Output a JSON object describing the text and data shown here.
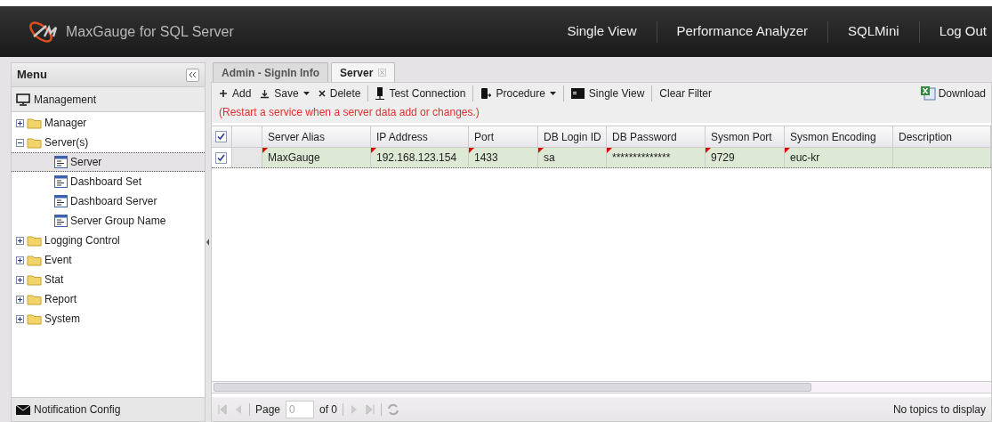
{
  "header": {
    "product": "MaxGauge for SQL Server",
    "nav": [
      {
        "label": "Single View"
      },
      {
        "label": "Performance Analyzer"
      },
      {
        "label": "SQLMini"
      },
      {
        "label": "Log Out"
      }
    ]
  },
  "sidebar": {
    "title": "Menu",
    "section": "Management",
    "tree": [
      {
        "label": "Manager",
        "expanded": false,
        "selected": false
      },
      {
        "label": "Server(s)",
        "expanded": true,
        "selected": false,
        "children": [
          {
            "label": "Server",
            "selected": true
          },
          {
            "label": "Dashboard Set",
            "selected": false
          },
          {
            "label": "Dashboard Server",
            "selected": false
          },
          {
            "label": "Server Group Name",
            "selected": false
          }
        ]
      },
      {
        "label": "Logging Control",
        "expanded": false,
        "selected": false
      },
      {
        "label": "Event",
        "expanded": false,
        "selected": false
      },
      {
        "label": "Stat",
        "expanded": false,
        "selected": false
      },
      {
        "label": "Report",
        "expanded": false,
        "selected": false
      },
      {
        "label": "System",
        "expanded": false,
        "selected": false
      }
    ],
    "footer": "Notification Config"
  },
  "tabs": [
    {
      "label": "Admin - SignIn Info",
      "selected": false,
      "closable": false
    },
    {
      "label": "Server",
      "selected": true,
      "closable": true
    }
  ],
  "toolbar": [
    {
      "label": "Add",
      "kind": "add",
      "dropdown": false,
      "separator_before": false
    },
    {
      "label": "Save",
      "kind": "save",
      "dropdown": true,
      "separator_before": false
    },
    {
      "label": "Delete",
      "kind": "delete",
      "dropdown": false,
      "separator_before": false
    },
    {
      "label": "Test Connection",
      "kind": "test",
      "dropdown": false,
      "separator_before": true
    },
    {
      "label": "Procedure",
      "kind": "procedure",
      "dropdown": true,
      "separator_before": true
    },
    {
      "label": "Single View",
      "kind": "view",
      "dropdown": false,
      "separator_before": true
    },
    {
      "label": "Clear Filter",
      "kind": "plain",
      "dropdown": false,
      "separator_before": true
    }
  ],
  "download": "Download",
  "notice": "(Restart a service when a server data add or changes.)",
  "table": {
    "all_checked": true,
    "columns": [
      "Server Alias",
      "IP Address",
      "Port",
      "DB Login ID",
      "DB Password",
      "Sysmon Port",
      "Sysmon Encoding",
      "Description"
    ],
    "rows": [
      {
        "checked": true,
        "selected": true,
        "cells": [
          {
            "text": "MaxGauge",
            "modified": true
          },
          {
            "text": "192.168.123.154",
            "modified": true
          },
          {
            "text": "1433",
            "modified": true
          },
          {
            "text": "sa",
            "modified": true
          },
          {
            "text": "**************",
            "modified": true
          },
          {
            "text": "9729",
            "modified": true
          },
          {
            "text": "euc-kr",
            "modified": true
          },
          {
            "modified": false
          }
        ]
      }
    ]
  },
  "pager": {
    "page_label": "Page",
    "page_value": "0",
    "of_label": "of 0",
    "status": "No topics to display"
  }
}
